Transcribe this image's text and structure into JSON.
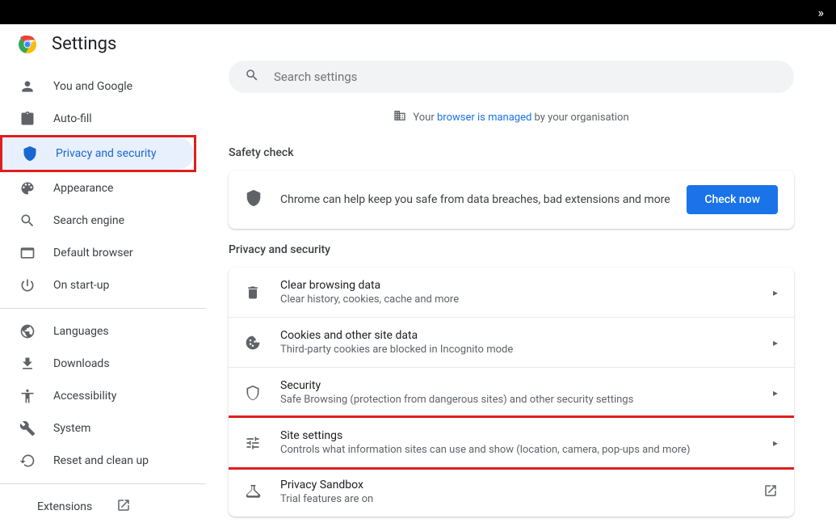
{
  "header": {
    "title": "Settings"
  },
  "search": {
    "placeholder": "Search settings"
  },
  "managed_notice": {
    "prefix": "Your ",
    "link": "browser is managed",
    "suffix": " by your organisation"
  },
  "sidebar": {
    "items": [
      {
        "label": "You and Google"
      },
      {
        "label": "Auto-fill"
      },
      {
        "label": "Privacy and security"
      },
      {
        "label": "Appearance"
      },
      {
        "label": "Search engine"
      },
      {
        "label": "Default browser"
      },
      {
        "label": "On start-up"
      },
      {
        "label": "Languages"
      },
      {
        "label": "Downloads"
      },
      {
        "label": "Accessibility"
      },
      {
        "label": "System"
      },
      {
        "label": "Reset and clean up"
      }
    ],
    "extensions": "Extensions"
  },
  "safety": {
    "section_title": "Safety check",
    "text": "Chrome can help keep you safe from data breaches, bad extensions and more",
    "button": "Check now"
  },
  "privacy": {
    "section_title": "Privacy and security",
    "rows": [
      {
        "title": "Clear browsing data",
        "subtitle": "Clear history, cookies, cache and more"
      },
      {
        "title": "Cookies and other site data",
        "subtitle": "Third-party cookies are blocked in Incognito mode"
      },
      {
        "title": "Security",
        "subtitle": "Safe Browsing (protection from dangerous sites) and other security settings"
      },
      {
        "title": "Site settings",
        "subtitle": "Controls what information sites can use and show (location, camera, pop-ups and more)"
      },
      {
        "title": "Privacy Sandbox",
        "subtitle": "Trial features are on"
      }
    ]
  }
}
